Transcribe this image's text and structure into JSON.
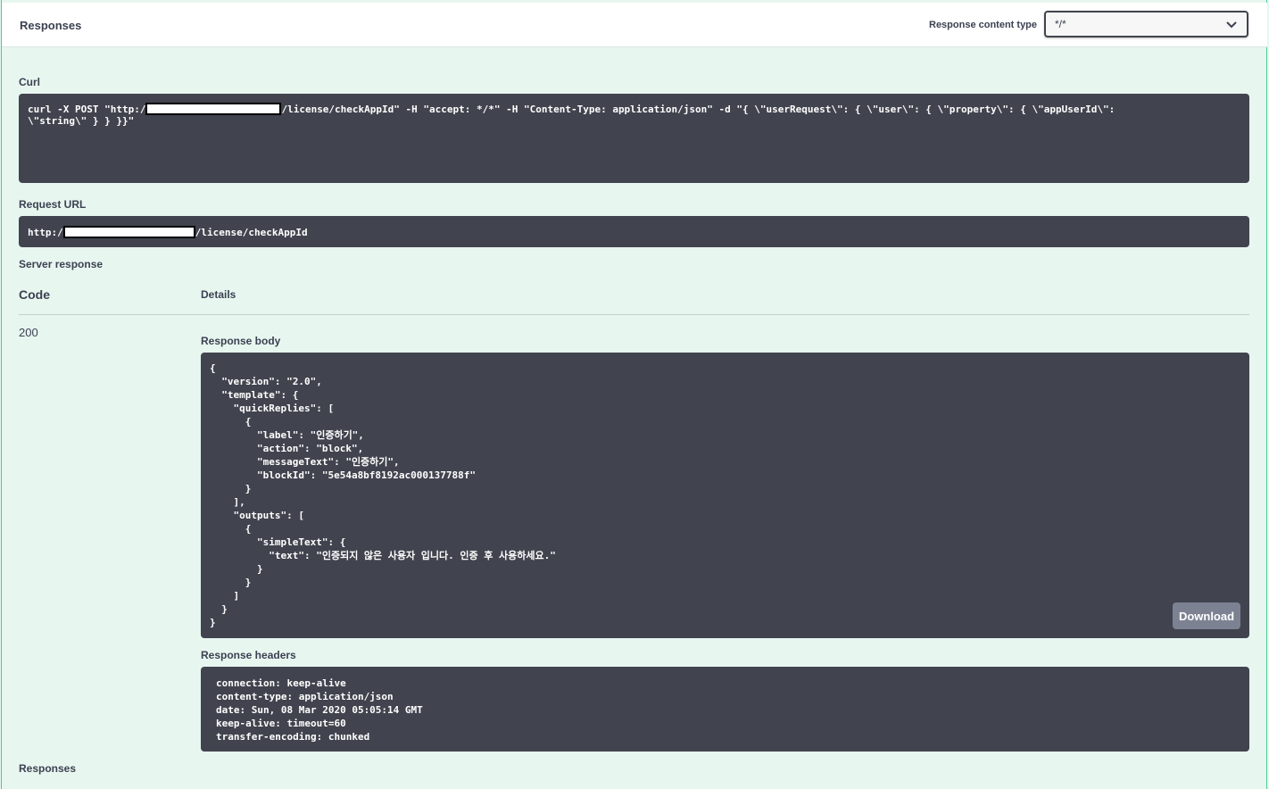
{
  "header": {
    "title": "Responses",
    "content_type_label": "Response content type",
    "content_type_value": "*/*"
  },
  "curl": {
    "label": "Curl",
    "line1_prefix": "curl -X POST \"http:/",
    "line1_suffix": "/license/checkAppId\" -H \"accept: */*\" -H \"Content-Type: application/json\" -d \"{ \\\"userRequest\\\": { \\\"user\\\": { \\\"property\\\": { \\\"appUserId\\\":",
    "line2": "\\\"string\\\" } } }}\""
  },
  "request_url": {
    "label": "Request URL",
    "prefix": "http:/",
    "suffix": "/license/checkAppId"
  },
  "server_response": {
    "label": "Server response",
    "code_header": "Code",
    "details_header": "Details",
    "code": "200",
    "body_label": "Response body",
    "body_lines": [
      "{",
      "  \"version\": \"2.0\",",
      "  \"template\": {",
      "    \"quickReplies\": [",
      "      {",
      "        \"label\": \"인증하기\",",
      "        \"action\": \"block\",",
      "        \"messageText\": \"인증하기\",",
      "        \"blockId\": \"5e54a8bf8192ac000137788f\"",
      "      }",
      "    ],",
      "    \"outputs\": [",
      "      {",
      "        \"simpleText\": {",
      "          \"text\": \"인증되지 않은 사용자 입니다. 인증 후 사용하세요.\"",
      "        }",
      "      }",
      "    ]",
      "  }",
      "}"
    ],
    "download_label": "Download",
    "headers_label": "Response headers",
    "headers_lines": [
      "connection: keep-alive",
      "content-type: application/json",
      "date: Sun, 08 Mar 2020 05:05:14 GMT",
      "keep-alive: timeout=60",
      "transfer-encoding: chunked"
    ]
  },
  "footer": {
    "label": "Responses"
  }
}
